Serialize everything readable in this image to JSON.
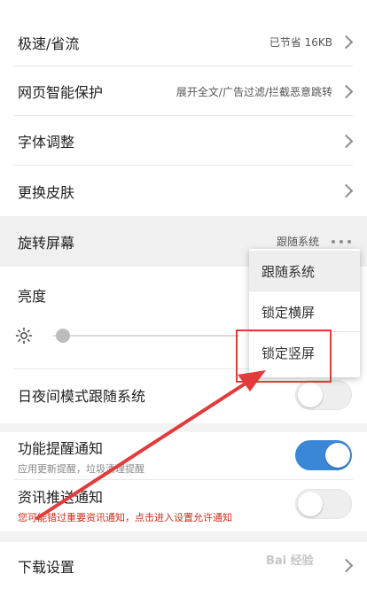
{
  "settings": {
    "speed_mode": {
      "label": "极速/省流",
      "value": "已节省 16KB"
    },
    "smart_protect": {
      "label": "网页智能保护",
      "value": "展开全文/广告过滤/拦截恶意跳转"
    },
    "font_adjust": {
      "label": "字体调整"
    },
    "change_skin": {
      "label": "更换皮肤"
    },
    "rotate_screen": {
      "label": "旋转屏幕",
      "value": "跟随系统"
    },
    "brightness": {
      "label": "亮度",
      "level": 0.05
    },
    "day_night": {
      "label": "日夜间模式跟随系统",
      "enabled": false
    },
    "feature_notice": {
      "label": "功能提醒通知",
      "sublabel": "应用更新提醒，垃圾清理提醒",
      "enabled": true
    },
    "news_push": {
      "label": "资讯推送通知",
      "warning": "您可能错过重要资讯通知，点击进入设置允许通知",
      "enabled": false
    },
    "download": {
      "label": "下载设置"
    }
  },
  "rotate_menu": {
    "options": [
      "跟随系统",
      "锁定横屏",
      "锁定竖屏"
    ],
    "selected": "跟随系统",
    "highlighted": "锁定竖屏"
  },
  "watermark": "Bai 经验",
  "colors": {
    "toggle_on": "#3a87d8",
    "highlight": "#e23b3b",
    "warning": "#d12b1a"
  }
}
